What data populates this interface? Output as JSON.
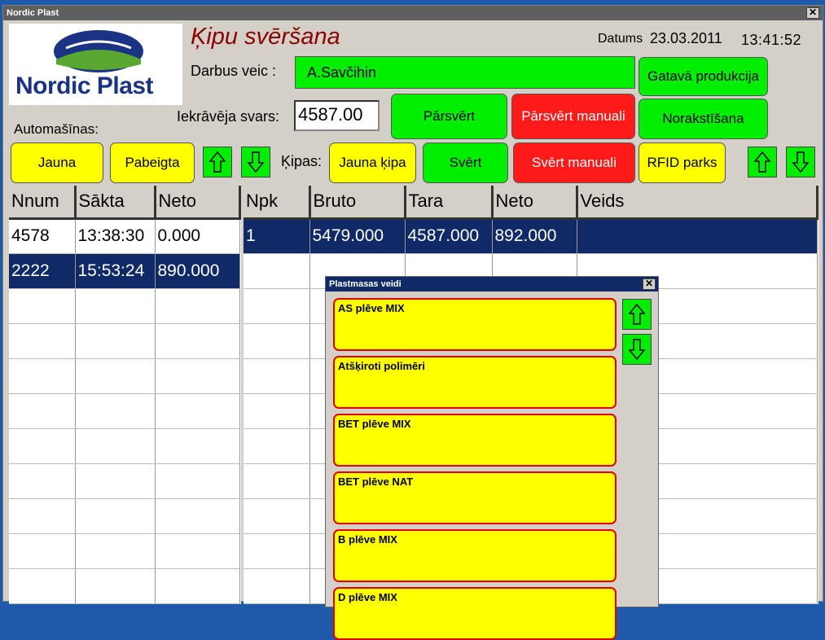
{
  "window": {
    "title": "Nordic Plast",
    "close": "✕"
  },
  "logo": {
    "text": "Nordic Plast"
  },
  "header": {
    "title": "Ķipu svēršana",
    "date_label": "Datums",
    "date": "23.03.2011",
    "time": "13:41:52"
  },
  "operator": {
    "label": "Darbus veic :",
    "value": "A.Savčihin"
  },
  "weight": {
    "label": "Iekrāvēja svars:",
    "value": "4587.00"
  },
  "buttons": {
    "finished_production": "Gatavā produkcija",
    "reweigh": "Pārsvērt",
    "reweigh_manual": "Pārsvērt manuali",
    "write_off": "Norakstīšana",
    "new_car": "Jauna",
    "finished": "Pabeigta",
    "new_bale": "Jauna ķipa",
    "weigh": "Svērt",
    "weigh_manual": "Svērt manuali",
    "rfid": "RFID parks"
  },
  "labels": {
    "cars": "Automašīnas:",
    "bales": "Ķipas:"
  },
  "cars_table": {
    "columns": [
      "Nnum",
      "Sākta",
      "Neto"
    ],
    "rows": [
      [
        "4578",
        "13:38:30",
        "0.000"
      ],
      [
        "2222",
        "15:53:24",
        "890.000"
      ]
    ]
  },
  "bales_table": {
    "columns": [
      "Npk",
      "Bruto",
      "Tara",
      "Neto",
      "Veids"
    ],
    "rows": [
      [
        "1",
        "5479.000",
        "4587.000",
        "892.000",
        ""
      ]
    ]
  },
  "plastic_dialog": {
    "title": "Plastmasas veidi",
    "close": "✕",
    "items": [
      "AS plēve MIX",
      "Atšķiroti polimēri",
      "BET plēve MIX",
      "BET plēve NAT",
      "B plēve MIX",
      "D plēve MIX"
    ]
  },
  "colors": {
    "green": "#00ee00",
    "red": "#ff1a1a",
    "yellow": "#ffff00",
    "selected_row": "#0f2a66",
    "title_red": "#8b0000"
  }
}
